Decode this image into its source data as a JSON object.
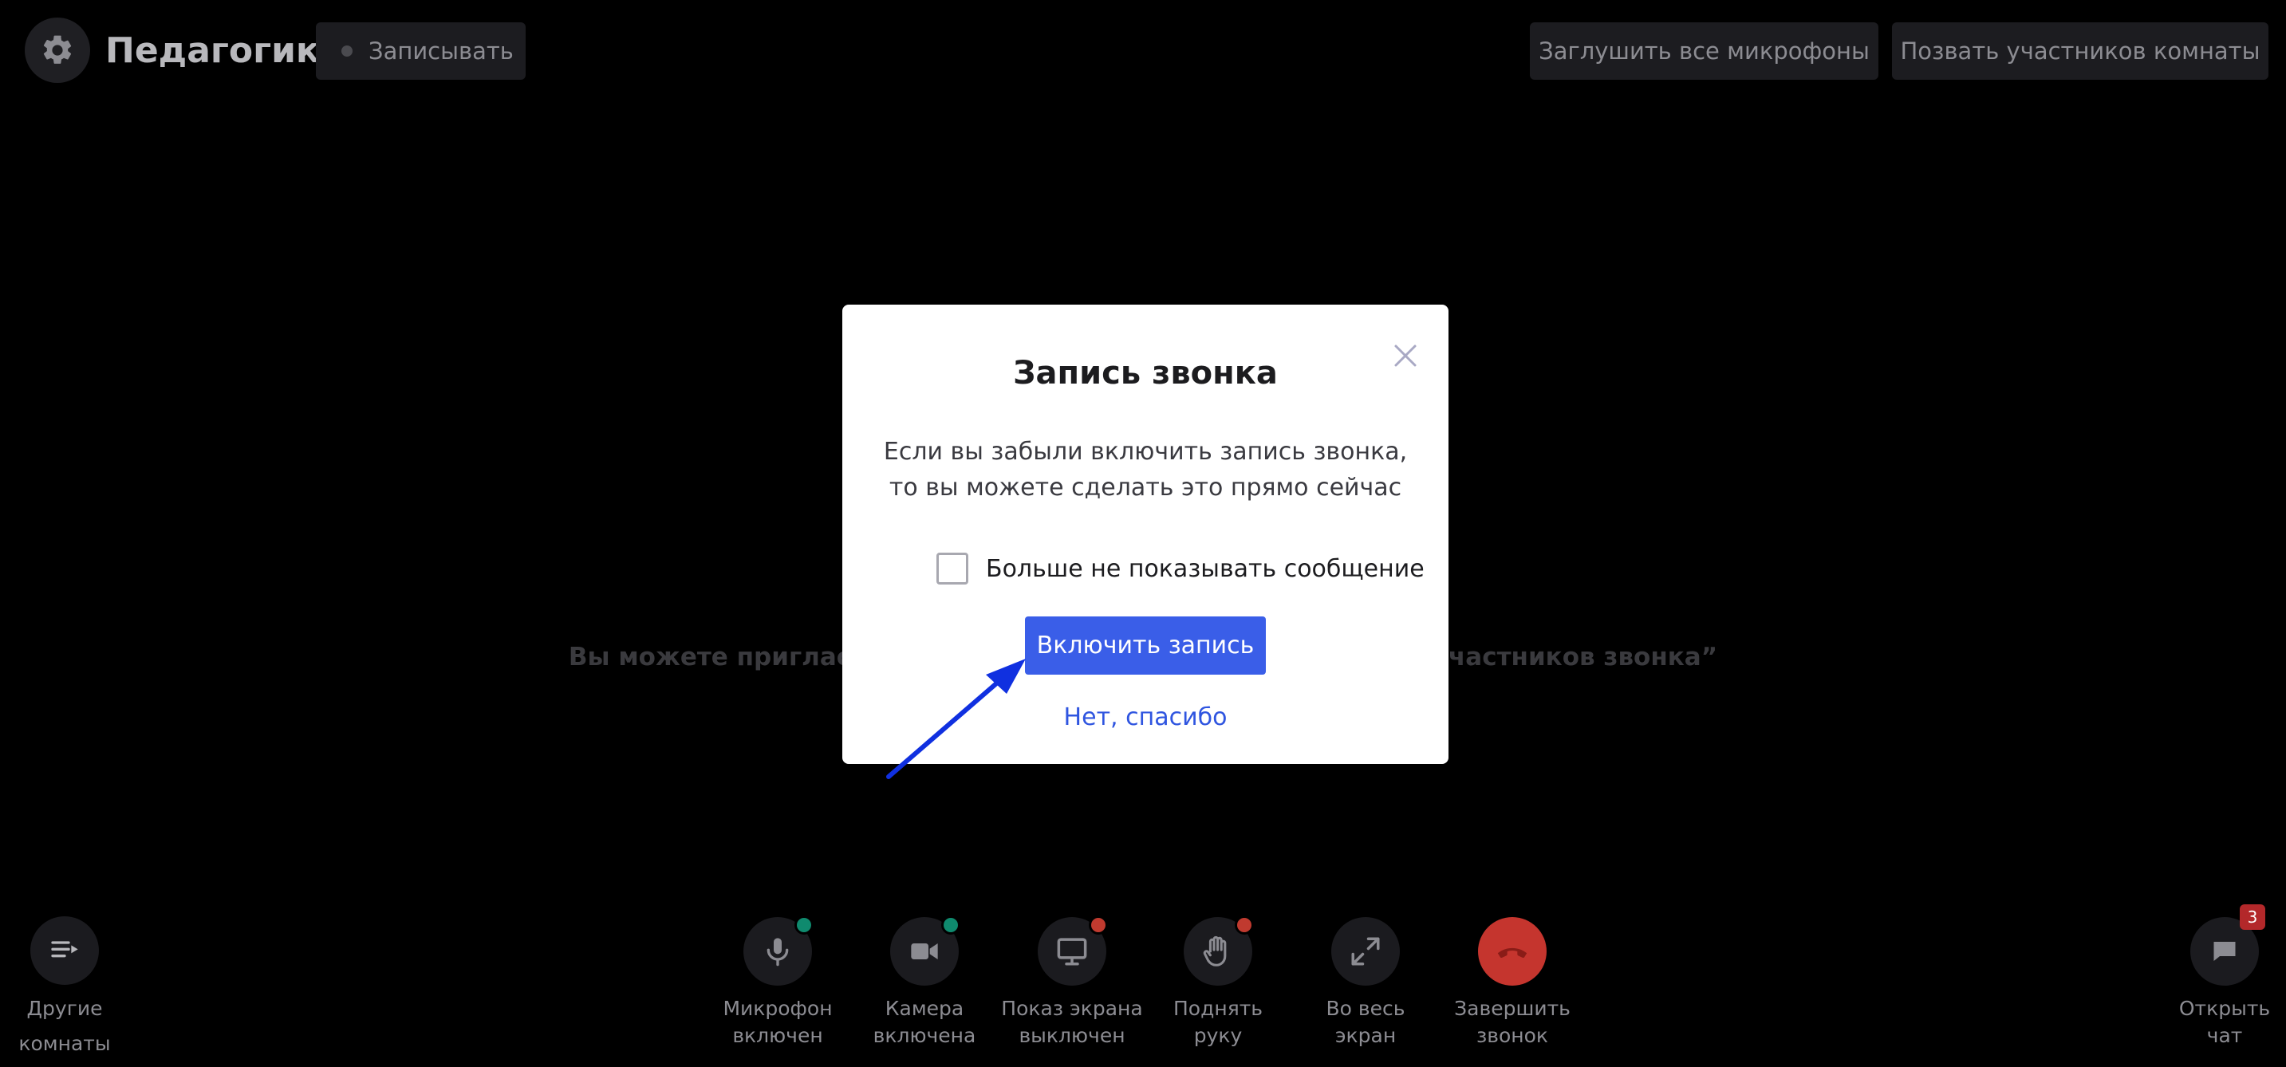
{
  "header": {
    "title": "Педагогика",
    "record_label": "Записывать",
    "mute_all_label": "Заглушить все микрофоны",
    "invite_all_label": "Позвать участников комнаты",
    "settings_icon": "gear-icon"
  },
  "background_message": {
    "text": "Вы можете пригласить участников звонка, нажав “Позвать участников звонка”"
  },
  "modal": {
    "title": "Запись звонка",
    "body_line1": "Если вы забыли включить запись звонка,",
    "body_line2": "то вы можете сделать это прямо сейчас",
    "checkbox_label": "Больше не показывать сообщение",
    "checkbox_checked": false,
    "primary_button": "Включить запись",
    "secondary_link": "Нет, спасибо",
    "close_icon": "close-icon",
    "accent_color": "#3a5ee8"
  },
  "annotation": {
    "arrow_color": "#1030e0"
  },
  "controls": {
    "other_rooms": {
      "line1": "Другие",
      "line2": "комнаты",
      "icon": "list-arrow-icon"
    },
    "microphone": {
      "line1": "Микрофон",
      "line2": "включен",
      "icon": "microphone-icon",
      "status_color": "#0f8a6e"
    },
    "camera": {
      "line1": "Камера",
      "line2": "включена",
      "icon": "camera-icon",
      "status_color": "#0f8a6e"
    },
    "screen_share": {
      "line1": "Показ экрана",
      "line2": "выключен",
      "icon": "monitor-icon",
      "status_color": "#c03a2f"
    },
    "raise_hand": {
      "line1": "Поднять",
      "line2": "руку",
      "icon": "hand-icon",
      "status_color": "#c03a2f"
    },
    "fullscreen": {
      "line1": "Во весь",
      "line2": "экран",
      "icon": "expand-icon"
    },
    "end_call": {
      "line1": "Завершить",
      "line2": "звонок",
      "icon": "phone-hangup-icon",
      "color": "#c5352e"
    },
    "chat": {
      "line1": "Открыть",
      "line2": "чат",
      "icon": "chat-icon",
      "badge": "3"
    }
  }
}
